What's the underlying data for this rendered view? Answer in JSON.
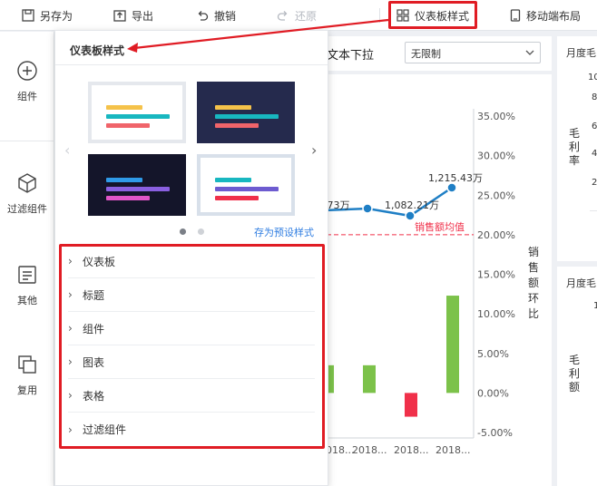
{
  "toolbar": {
    "save_as": "另存为",
    "export": "导出",
    "undo": "撤销",
    "redo": "还原",
    "dashboard_style": "仪表板样式",
    "mobile_layout": "移动端布局"
  },
  "sidebar": {
    "items": [
      {
        "label": "组件",
        "icon": "plus-circle-icon"
      },
      {
        "label": "过滤组件",
        "icon": "cube-icon"
      },
      {
        "label": "其他",
        "icon": "text-box-icon"
      },
      {
        "label": "复用",
        "icon": "copy-icon"
      }
    ]
  },
  "panel": {
    "title": "仪表板样式",
    "save_preset": "存为预设样式",
    "menu": [
      "仪表板",
      "标题",
      "组件",
      "图表",
      "表格",
      "过滤组件"
    ]
  },
  "filter": {
    "label": "文本下拉",
    "select_value": "无限制"
  },
  "right_cards": {
    "card1_title": "月度毛",
    "card1_axis": [
      "毛",
      "利",
      "率"
    ],
    "card1_ticks": [
      "10",
      "8",
      "6",
      "4",
      "2"
    ],
    "card2_title": "月度毛",
    "card2_axis": [
      "毛",
      "利",
      "额"
    ],
    "card2_ticks": [
      "1"
    ]
  },
  "colors": {
    "highlight": "#e01c24",
    "accent": "#2f7de1",
    "line": "#1f7fc5",
    "bar_positive": "#7cc24a",
    "bar_negative": "#f0304a"
  },
  "chart_data": {
    "type": "bar",
    "y2label": "销售额环比",
    "y2_ticks": [
      "35.00%",
      "30.00%",
      "25.00%",
      "20.00%",
      "15.00%",
      "10.00%",
      "5.00%",
      "0.00%",
      "-5.00%"
    ],
    "y2lim": [
      -5,
      35
    ],
    "x_tick_labels": [
      "2018...",
      "2018...",
      "2018...",
      "2018..."
    ],
    "bars": [
      {
        "value": 3.5
      },
      {
        "value": 3.5
      },
      {
        "value": -3.0
      },
      {
        "value": 12.3
      }
    ],
    "line_labels": [
      "...73万",
      "1,082.21万",
      "1,215.43万"
    ],
    "reference_line": {
      "label": "销售额均值",
      "value": 20.0
    }
  }
}
